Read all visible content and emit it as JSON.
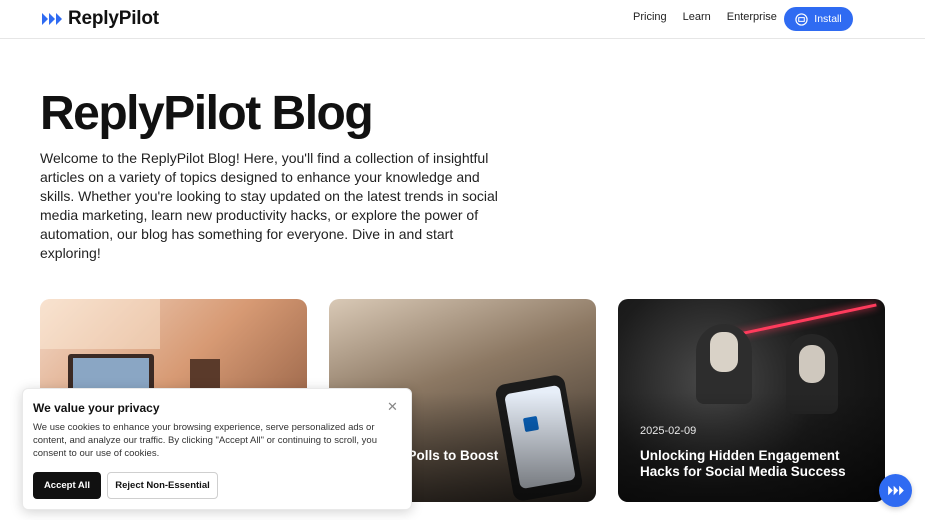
{
  "header": {
    "brand": "ReplyPilot",
    "nav": [
      "Pricing",
      "Learn",
      "Enterprise"
    ],
    "install_label": "Install",
    "accent": "#2f6bf2"
  },
  "hero": {
    "title": "ReplyPilot Blog",
    "description": "Welcome to the ReplyPilot Blog! Here, you'll find a collection of insightful articles on a variety of topics designed to enhance your knowledge and skills. Whether you're looking to stay updated on the latest trends in social media marketing, learn new productivity hacks, or explore the power of automation, our blog has something for everyone. Dive in and start exploring!"
  },
  "cards": [
    {
      "date": "",
      "title": ""
    },
    {
      "date": "",
      "title": "Use LinkedIn Polls to Boost Engagement in 2025",
      "visible_title": "e LinkedIn Polls to Boost\nent in 2025"
    },
    {
      "date": "2025-02-09",
      "title": "Unlocking Hidden Engagement Hacks for Social Media Success"
    }
  ],
  "cookie": {
    "title": "We value your privacy",
    "text": "We use cookies to enhance your browsing experience, serve personalized ads or content, and analyze our traffic. By clicking \"Accept All\" or continuing to scroll, you consent to our use of cookies.",
    "accept_label": "Accept All",
    "reject_label": "Reject Non-Essential",
    "close_icon": "close-icon"
  },
  "icons": {
    "logo": "fast-forward-icon",
    "install": "chatgpt-icon",
    "fab": "fast-forward-icon"
  }
}
